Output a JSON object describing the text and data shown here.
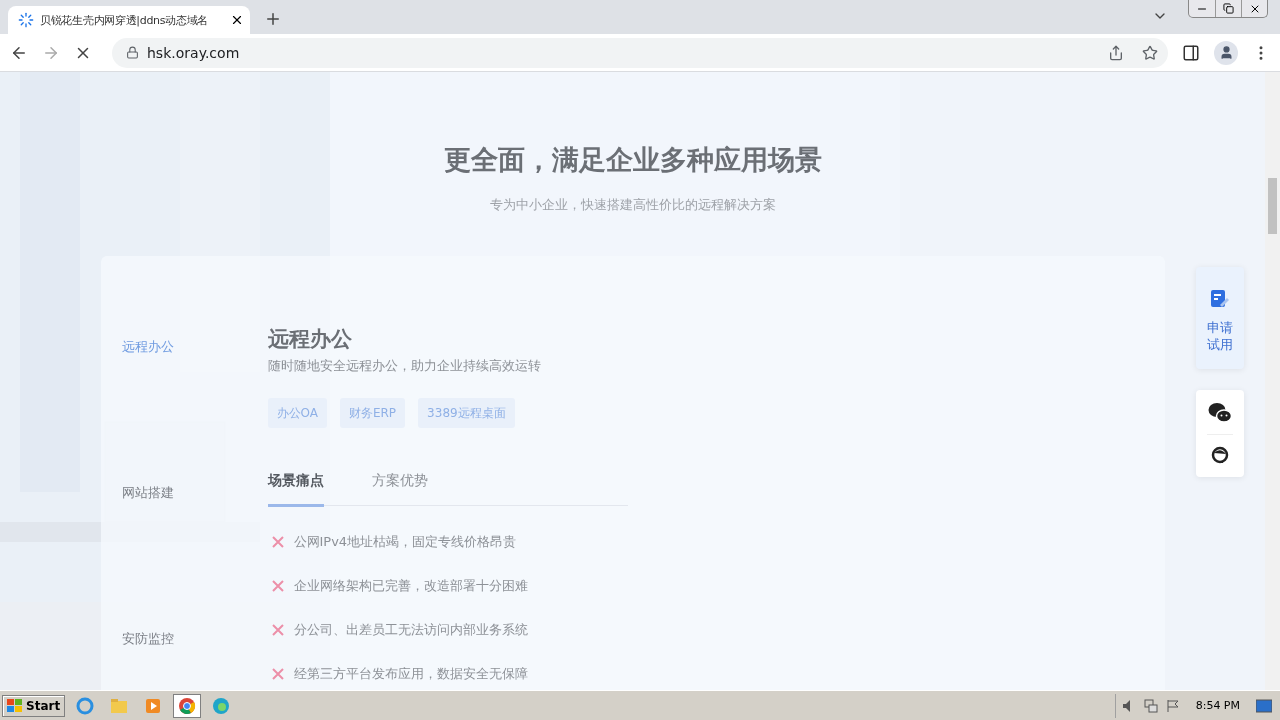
{
  "browser": {
    "tab_title": "贝锐花生壳内网穿透|ddns动态域名",
    "url": "hsk.oray.com",
    "loading": true
  },
  "page": {
    "heading": "更全面，满足企业多种应用场景",
    "subheading": "专为中小企业，快速搭建高性价比的远程解决方案",
    "sidebar": [
      {
        "label": "远程办公",
        "selected": true
      },
      {
        "label": "网站搭建",
        "selected": false
      },
      {
        "label": "安防监控",
        "selected": false
      }
    ],
    "section": {
      "title": "远程办公",
      "description": "随时随地安全远程办公，助力企业持续高效运转",
      "tags": [
        "办公OA",
        "财务ERP",
        "3389远程桌面"
      ],
      "tabs": [
        {
          "label": "场景痛点",
          "selected": true
        },
        {
          "label": "方案优势",
          "selected": false
        }
      ],
      "pain_points": [
        "公网IPv4地址枯竭，固定专线价格昂贵",
        "企业网络架构已完善，改造部署十分困难",
        "分公司、出差员工无法访问内部业务系统",
        "经第三方平台发布应用，数据安全无保障"
      ]
    },
    "float_panel": {
      "trial_label": "申请试用"
    }
  },
  "taskbar": {
    "start": "Start",
    "clock": "8:54 PM"
  }
}
